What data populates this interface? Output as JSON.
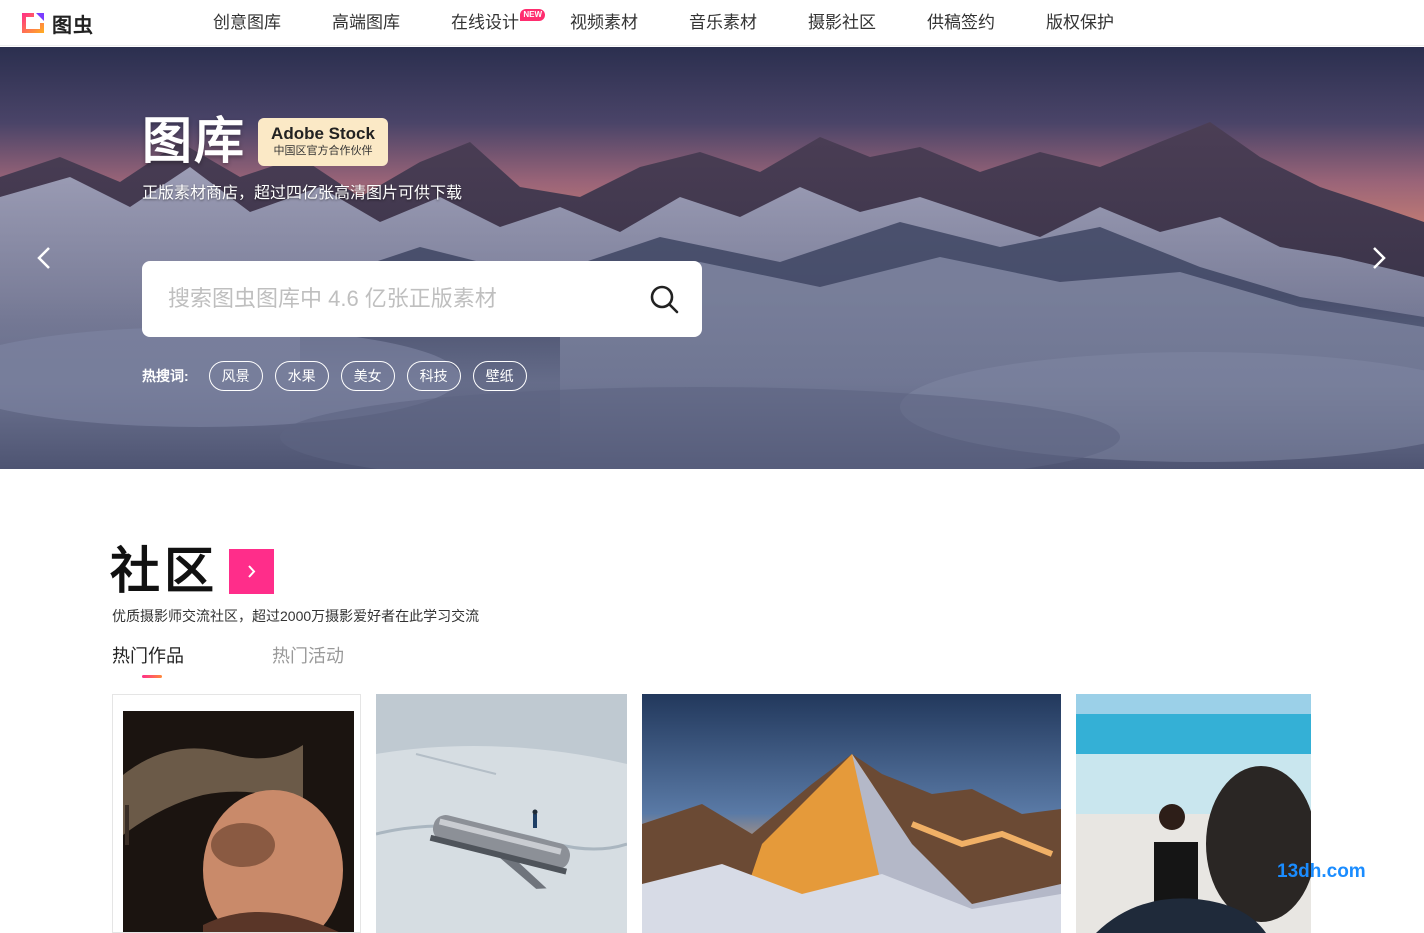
{
  "header": {
    "logo_text": "图虫",
    "nav": [
      {
        "label": "创意图库"
      },
      {
        "label": "高端图库"
      },
      {
        "label": "在线设计",
        "badge": "NEW"
      },
      {
        "label": "视频素材"
      },
      {
        "label": "音乐素材"
      },
      {
        "label": "摄影社区"
      },
      {
        "label": "供稿签约"
      },
      {
        "label": "版权保护"
      }
    ]
  },
  "hero": {
    "title": "图库",
    "badge_line1": "Adobe Stock",
    "badge_line2": "中国区官方合作伙伴",
    "subtitle": "正版素材商店，超过四亿张高清图片可供下载",
    "search_placeholder": "搜索图虫图库中 4.6 亿张正版素材",
    "hot_label": "热搜词:",
    "hot_tags": [
      "风景",
      "水果",
      "美女",
      "科技",
      "壁纸"
    ]
  },
  "community": {
    "title": "社区",
    "subtitle": "优质摄影师交流社区，超过2000万摄影爱好者在此学习交流",
    "tabs": [
      "热门作品",
      "热门活动"
    ],
    "active_tab": 0
  },
  "watermark": "13dh.com",
  "colors": {
    "accent": "#ff2d8a",
    "badge_bg": "#fbe9c6",
    "new_badge": "#ff2d6f",
    "watermark": "#1a8cff"
  },
  "icons": {
    "search": "search-icon",
    "prev": "chevron-left-icon",
    "next": "chevron-right-icon",
    "more": "chevron-right-icon"
  }
}
